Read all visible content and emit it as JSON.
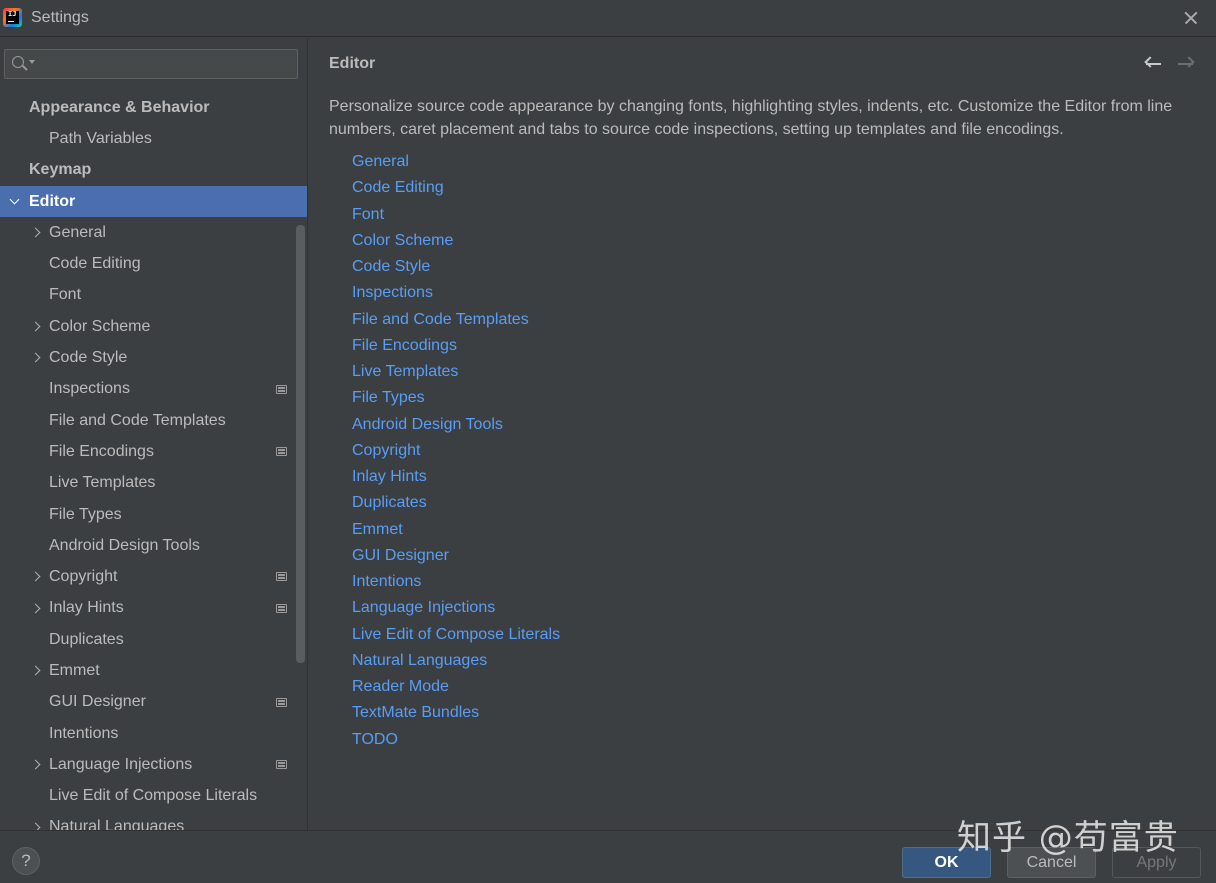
{
  "window": {
    "title": "Settings",
    "icon": "intellij-idea-icon"
  },
  "search": {
    "placeholder": "",
    "value": ""
  },
  "sidebar": {
    "items": [
      {
        "label": "Appearance & Behavior",
        "level": 0,
        "bold": true,
        "expander": "none",
        "project_icon": false
      },
      {
        "label": "Path Variables",
        "level": 1,
        "bold": false,
        "expander": "none",
        "project_icon": false
      },
      {
        "label": "Keymap",
        "level": 0,
        "bold": true,
        "expander": "none",
        "project_icon": false
      },
      {
        "label": "Editor",
        "level": 0,
        "bold": true,
        "expander": "down",
        "project_icon": false,
        "selected": true
      },
      {
        "label": "General",
        "level": 1,
        "bold": false,
        "expander": "right",
        "project_icon": false
      },
      {
        "label": "Code Editing",
        "level": 1,
        "bold": false,
        "expander": "none",
        "project_icon": false
      },
      {
        "label": "Font",
        "level": 1,
        "bold": false,
        "expander": "none",
        "project_icon": false
      },
      {
        "label": "Color Scheme",
        "level": 1,
        "bold": false,
        "expander": "right",
        "project_icon": false
      },
      {
        "label": "Code Style",
        "level": 1,
        "bold": false,
        "expander": "right",
        "project_icon": false
      },
      {
        "label": "Inspections",
        "level": 1,
        "bold": false,
        "expander": "none",
        "project_icon": true
      },
      {
        "label": "File and Code Templates",
        "level": 1,
        "bold": false,
        "expander": "none",
        "project_icon": false
      },
      {
        "label": "File Encodings",
        "level": 1,
        "bold": false,
        "expander": "none",
        "project_icon": true
      },
      {
        "label": "Live Templates",
        "level": 1,
        "bold": false,
        "expander": "none",
        "project_icon": false
      },
      {
        "label": "File Types",
        "level": 1,
        "bold": false,
        "expander": "none",
        "project_icon": false
      },
      {
        "label": "Android Design Tools",
        "level": 1,
        "bold": false,
        "expander": "none",
        "project_icon": false
      },
      {
        "label": "Copyright",
        "level": 1,
        "bold": false,
        "expander": "right",
        "project_icon": true
      },
      {
        "label": "Inlay Hints",
        "level": 1,
        "bold": false,
        "expander": "right",
        "project_icon": true
      },
      {
        "label": "Duplicates",
        "level": 1,
        "bold": false,
        "expander": "none",
        "project_icon": false
      },
      {
        "label": "Emmet",
        "level": 1,
        "bold": false,
        "expander": "right",
        "project_icon": false
      },
      {
        "label": "GUI Designer",
        "level": 1,
        "bold": false,
        "expander": "none",
        "project_icon": true
      },
      {
        "label": "Intentions",
        "level": 1,
        "bold": false,
        "expander": "none",
        "project_icon": false
      },
      {
        "label": "Language Injections",
        "level": 1,
        "bold": false,
        "expander": "right",
        "project_icon": true
      },
      {
        "label": "Live Edit of Compose Literals",
        "level": 1,
        "bold": false,
        "expander": "none",
        "project_icon": false
      },
      {
        "label": "Natural Languages",
        "level": 1,
        "bold": false,
        "expander": "right",
        "project_icon": false
      }
    ]
  },
  "main": {
    "title": "Editor",
    "description": "Personalize source code appearance by changing fonts, highlighting styles, indents, etc. Customize the Editor from line numbers, caret placement and tabs to source code inspections, setting up templates and file encodings.",
    "links": [
      "General",
      "Code Editing",
      "Font",
      "Color Scheme",
      "Code Style",
      "Inspections",
      "File and Code Templates",
      "File Encodings",
      "Live Templates",
      "File Types",
      "Android Design Tools",
      "Copyright",
      "Inlay Hints",
      "Duplicates",
      "Emmet",
      "GUI Designer",
      "Intentions",
      "Language Injections",
      "Live Edit of Compose Literals",
      "Natural Languages",
      "Reader Mode",
      "TextMate Bundles",
      "TODO"
    ]
  },
  "footer": {
    "help_label": "?",
    "ok_label": "OK",
    "cancel_label": "Cancel",
    "apply_label": "Apply"
  },
  "watermark": "知乎 @苟富贵",
  "colors": {
    "background": "#3c3f41",
    "selection": "#4b6eaf",
    "link": "#589df6",
    "ok_button": "#365880"
  }
}
